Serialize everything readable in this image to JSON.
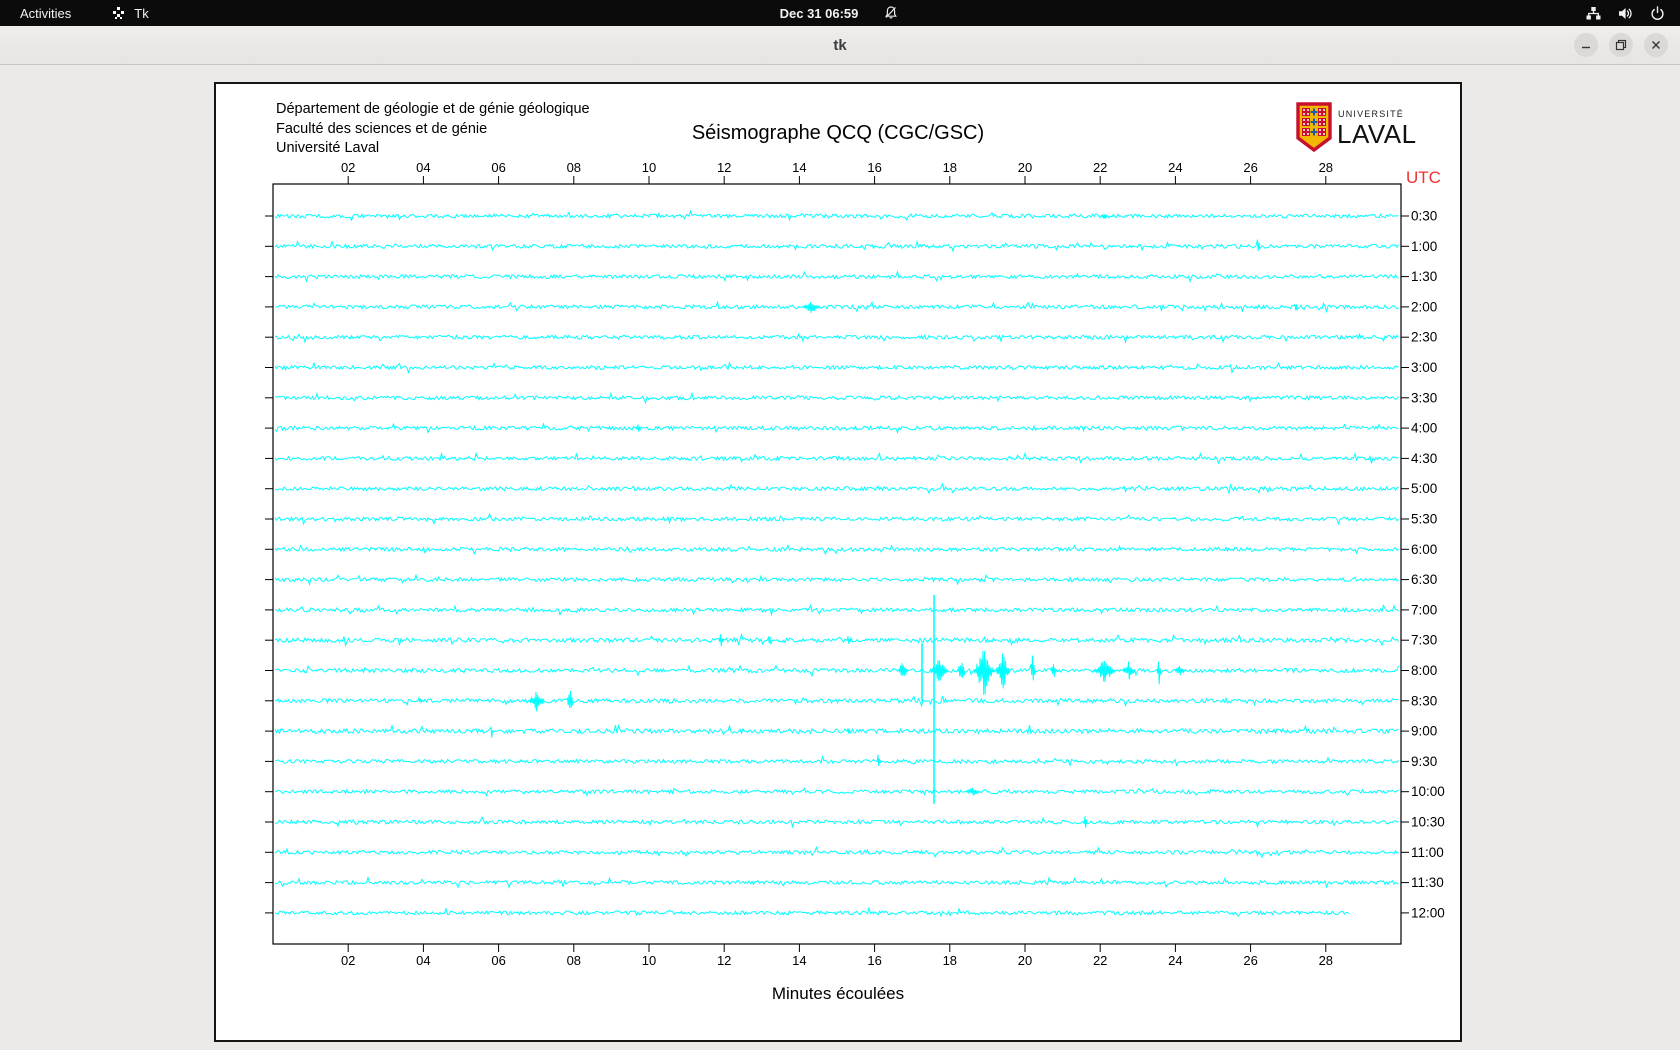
{
  "desktop": {
    "top_bar": {
      "activities_label": "Activities",
      "app_name": "Tk",
      "clock": "Dec 31  06:59",
      "status_icons": [
        "notifications-off-icon",
        "network-wired-icon",
        "volume-icon",
        "power-icon"
      ]
    },
    "window": {
      "title": "tk",
      "controls": [
        "minimize",
        "maximize",
        "close"
      ]
    }
  },
  "seismograph": {
    "header_lines": [
      "Département de géologie et de génie géologique",
      "Faculté des sciences et de génie",
      "Université Laval"
    ],
    "title": "Séismographe QCQ (CGC/GSC)",
    "logo": {
      "line1": "UNIVERSITÉ",
      "line2": "LAVAL"
    },
    "utc_label": "UTC",
    "xlabel": "Minutes écoulées",
    "trace_color": "#00ffff",
    "chart_data": {
      "type": "seismogram",
      "x_axis": {
        "min": 0,
        "max": 30,
        "tick_step": 2,
        "tick_labels": [
          "02",
          "04",
          "06",
          "08",
          "10",
          "12",
          "14",
          "16",
          "18",
          "20",
          "22",
          "24",
          "26",
          "28"
        ]
      },
      "rows": [
        {
          "label": "0:30",
          "events": [
            {
              "m": 22.1,
              "w": 0.2,
              "up": 4,
              "down": 4
            }
          ]
        },
        {
          "label": "1:00",
          "events": [
            {
              "m": 26.2,
              "w": 0.1,
              "up": 11,
              "down": 11
            }
          ]
        },
        {
          "label": "1:30",
          "events": []
        },
        {
          "label": "2:00",
          "events": [
            {
              "m": 14.3,
              "w": 0.5,
              "up": 5,
              "down": 6
            },
            {
              "m": 27.2,
              "w": 0.08,
              "up": 7,
              "down": 7
            }
          ]
        },
        {
          "label": "2:30",
          "events": []
        },
        {
          "label": "3:00",
          "events": []
        },
        {
          "label": "3:30",
          "events": []
        },
        {
          "label": "4:00",
          "events": [
            {
              "m": 9.7,
              "w": 0.15,
              "up": 4,
              "down": 4
            }
          ]
        },
        {
          "label": "4:30",
          "events": []
        },
        {
          "label": "5:00",
          "events": []
        },
        {
          "label": "5:30",
          "events": []
        },
        {
          "label": "6:00",
          "events": []
        },
        {
          "label": "6:30",
          "events": []
        },
        {
          "label": "7:00",
          "events": []
        },
        {
          "label": "7:30",
          "noise": 1.15,
          "events": [
            {
              "m": 11.9,
              "w": 0.15,
              "up": 6,
              "down": 6
            },
            {
              "m": 13.2,
              "w": 0.1,
              "up": 7,
              "down": 7
            },
            {
              "m": 15.3,
              "w": 0.1,
              "up": 5,
              "down": 6
            }
          ]
        },
        {
          "label": "8:00",
          "noise": 1.1,
          "events": [
            {
              "m": 16.75,
              "w": 0.25,
              "up": 12,
              "down": 12
            },
            {
              "m": 17.7,
              "w": 0.5,
              "up": 11,
              "down": 11
            },
            {
              "m": 18.3,
              "w": 0.2,
              "up": 13,
              "down": 13
            },
            {
              "m": 18.9,
              "w": 0.55,
              "up": 21,
              "down": 26
            },
            {
              "m": 19.4,
              "w": 0.4,
              "up": 17,
              "down": 18
            },
            {
              "m": 20.2,
              "w": 0.15,
              "up": 15,
              "down": 10
            },
            {
              "m": 20.75,
              "w": 0.2,
              "up": 7,
              "down": 7
            },
            {
              "m": 22.1,
              "w": 0.6,
              "up": 10,
              "down": 12
            },
            {
              "m": 22.75,
              "w": 0.35,
              "up": 9,
              "down": 9
            },
            {
              "m": 23.55,
              "w": 0.12,
              "up": 9,
              "down": 14
            },
            {
              "m": 24.1,
              "w": 0.3,
              "up": 5,
              "down": 5
            }
          ]
        },
        {
          "label": "8:30",
          "noise": 1.1,
          "events": [
            {
              "m": 3.9,
              "w": 0.1,
              "up": 5,
              "down": 5
            },
            {
              "m": 7.0,
              "w": 0.45,
              "up": 9,
              "down": 11
            },
            {
              "m": 7.9,
              "w": 0.18,
              "up": 17,
              "down": 20
            }
          ]
        },
        {
          "label": "9:00",
          "noise": 1.2,
          "events": [
            {
              "m": 5.8,
              "w": 0.08,
              "up": 4,
              "down": 7
            },
            {
              "m": 15.3,
              "w": 0.1,
              "up": 6,
              "down": 7
            }
          ]
        },
        {
          "label": "9:30",
          "events": [
            {
              "m": 16.1,
              "w": 0.1,
              "up": 14,
              "down": 6
            }
          ]
        },
        {
          "label": "10:00",
          "events": [
            {
              "m": 18.6,
              "w": 0.4,
              "up": 4,
              "down": 4
            }
          ]
        },
        {
          "label": "10:30",
          "events": [
            {
              "m": 21.6,
              "w": 0.15,
              "up": 6,
              "down": 6
            }
          ]
        },
        {
          "label": "11:00",
          "events": []
        },
        {
          "label": "11:30",
          "events": []
        },
        {
          "label": "12:00",
          "end_min": 28.65,
          "events": []
        }
      ],
      "crossing_spikes": [
        {
          "m": 17.26,
          "top_row": 15,
          "top_off": 3,
          "bot_row": 17,
          "bot_off": 0
        },
        {
          "m": 17.58,
          "top_row": 14,
          "top_off": -15,
          "bot_row": 20,
          "bot_off": 12
        }
      ]
    }
  }
}
